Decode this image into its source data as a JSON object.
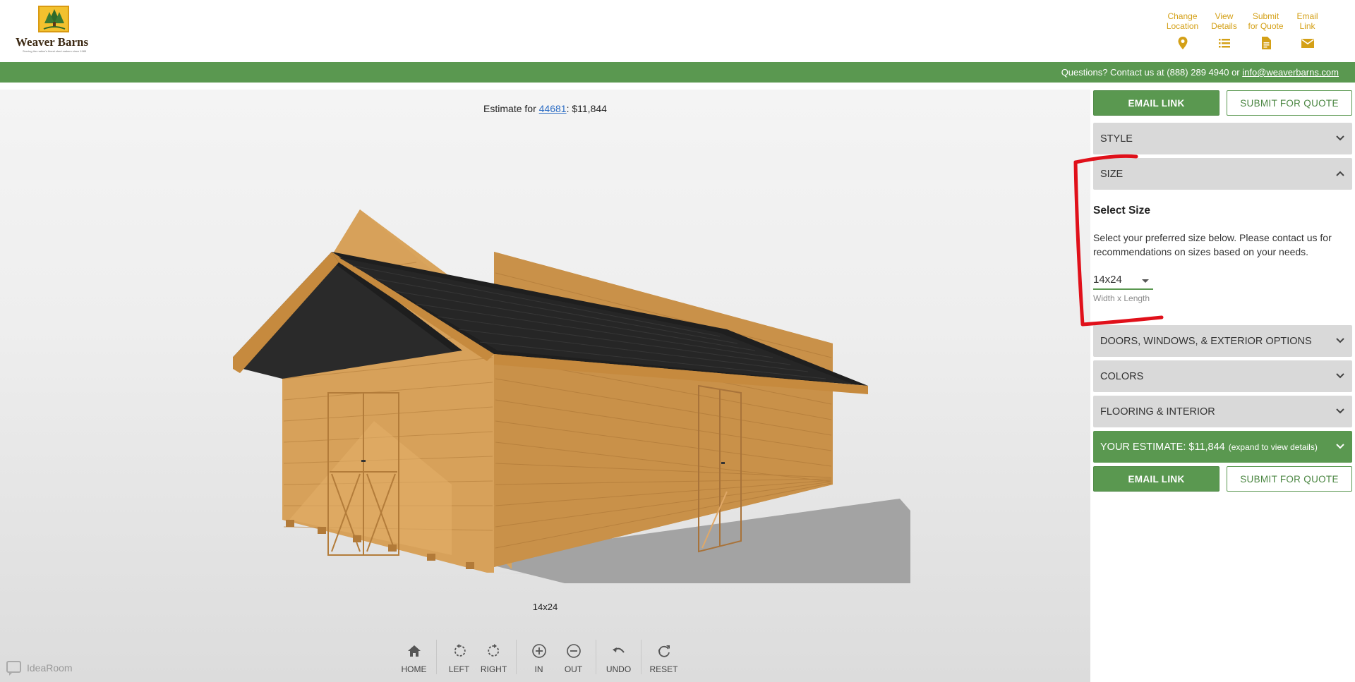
{
  "brand": {
    "name": "Weaver Barns",
    "tagline": "Serving the nation's finest shed makers since 1985",
    "colors": {
      "green": "#5a9850",
      "gold": "#d4a017",
      "panel_gray": "#d9d9d9"
    }
  },
  "top_actions": [
    {
      "label": "Change\nLocation",
      "icon": "location-pin-icon"
    },
    {
      "label": "View\nDetails",
      "icon": "list-icon"
    },
    {
      "label": "Submit\nfor Quote",
      "icon": "document-icon"
    },
    {
      "label": "Email\nLink",
      "icon": "envelope-icon"
    }
  ],
  "contact_bar": {
    "prefix": "Questions? Contact us at (888) 289 4940 or ",
    "email": "info@weaverbarns.com"
  },
  "viewer": {
    "estimate_prefix": "Estimate for ",
    "zip": "44681",
    "estimate_suffix": ": $11,844",
    "size_label": "14x24",
    "controls": [
      {
        "group": 0,
        "label": "HOME",
        "icon": "home-icon"
      },
      {
        "group": 1,
        "label": "LEFT",
        "icon": "rotate-left-icon"
      },
      {
        "group": 1,
        "label": "RIGHT",
        "icon": "rotate-right-icon"
      },
      {
        "group": 2,
        "label": "IN",
        "icon": "zoom-in-icon"
      },
      {
        "group": 2,
        "label": "OUT",
        "icon": "zoom-out-icon"
      },
      {
        "group": 3,
        "label": "UNDO",
        "icon": "undo-icon"
      },
      {
        "group": 4,
        "label": "RESET",
        "icon": "reset-icon"
      }
    ],
    "watermark": "IdeaRoom"
  },
  "panel": {
    "email_link": "EMAIL LINK",
    "submit_quote": "SUBMIT FOR QUOTE",
    "sections": {
      "style": "STYLE",
      "size": "SIZE",
      "doors": "DOORS, WINDOWS, & EXTERIOR OPTIONS",
      "colors": "COLORS",
      "flooring": "FLOORING & INTERIOR"
    },
    "size_section": {
      "title": "Select Size",
      "description": "Select your preferred size below. Please contact us for recommendations on sizes based on your needs.",
      "selected": "14x24",
      "hint": "Width x Length"
    },
    "estimate": {
      "label": "YOUR ESTIMATE: $11,844",
      "note": "(expand to view details)"
    }
  }
}
